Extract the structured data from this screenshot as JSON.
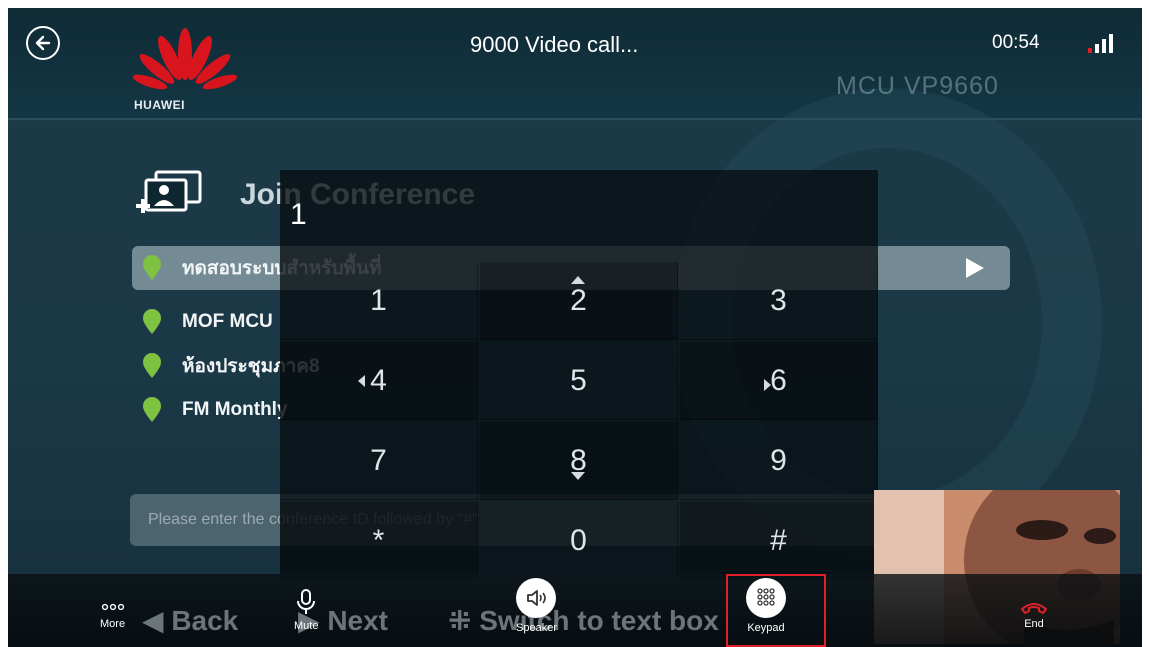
{
  "status_bar": {
    "call_title": "9000 Video call...",
    "timer": "00:54"
  },
  "remote": {
    "logo_text": "HUAWEI",
    "mcu_label": "MCU VP9660",
    "join_title": "Join Conference",
    "conferences": [
      {
        "name": "ทดสอบระบบสำหรับพื้นที่"
      },
      {
        "name": "MOF MCU"
      },
      {
        "name": "ห้องประชุมภาค8"
      },
      {
        "name": "FM Monthly"
      }
    ],
    "conference_input_placeholder": "Please enter the conference ID followed by \"#\"",
    "hints": {
      "back": "Back",
      "next": "Next",
      "switch": "Switch to text box"
    }
  },
  "keypad": {
    "display": "1",
    "keys": [
      "1",
      "2",
      "3",
      "4",
      "5",
      "6",
      "7",
      "8",
      "9",
      "*",
      "0",
      "#"
    ]
  },
  "toolbar": {
    "more": "More",
    "mute": "Mute",
    "speaker": "Speaker",
    "keypad": "Keypad",
    "end": "End"
  },
  "colors": {
    "end_call": "#e02028",
    "highlight": "#e02028",
    "pin": "#7ec241"
  }
}
